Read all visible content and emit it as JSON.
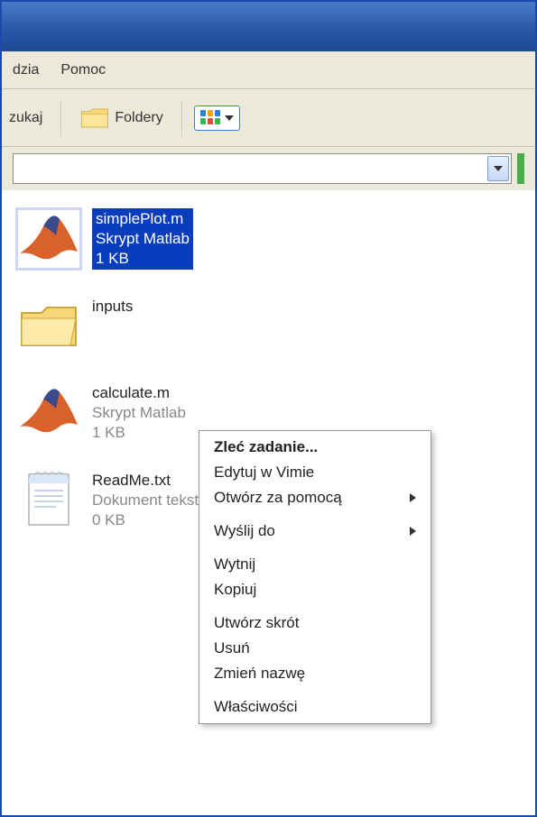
{
  "menubar": {
    "items": [
      "dzia",
      "Pomoc"
    ]
  },
  "toolbar": {
    "search_label": "zukaj",
    "folders_label": "Foldery"
  },
  "files": [
    {
      "name": "simplePlot.m",
      "type": "Skrypt Matlab",
      "size": "1 KB",
      "icon": "matlab",
      "selected": true
    },
    {
      "name": "inputs",
      "type": "",
      "size": "",
      "icon": "folder",
      "selected": false
    },
    {
      "name": "calculate.m",
      "type": "Skrypt Matlab",
      "size": "1 KB",
      "icon": "matlab",
      "selected": false
    },
    {
      "name": "ReadMe.txt",
      "type": "Dokument tekstowy",
      "size": "0 KB",
      "icon": "text",
      "selected": false
    }
  ],
  "context_menu": {
    "items": [
      {
        "label": "Zleć zadanie...",
        "bold": true
      },
      {
        "label": "Edytuj w Vimie"
      },
      {
        "label": "Otwórz za pomocą",
        "submenu": true
      },
      {
        "sep": true
      },
      {
        "label": "Wyślij do",
        "submenu": true
      },
      {
        "sep": true
      },
      {
        "label": "Wytnij"
      },
      {
        "label": "Kopiuj"
      },
      {
        "sep": true
      },
      {
        "label": "Utwórz skrót"
      },
      {
        "label": "Usuń"
      },
      {
        "label": "Zmień nazwę"
      },
      {
        "sep": true
      },
      {
        "label": "Właściwości"
      }
    ]
  }
}
